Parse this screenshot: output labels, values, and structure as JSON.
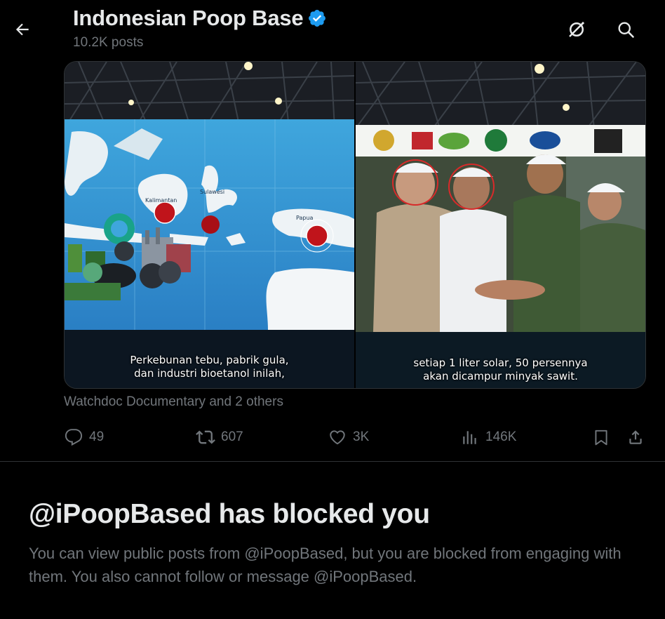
{
  "header": {
    "title": "Indonesian Poop Base",
    "subtitle": "10.2K posts",
    "icons": [
      "back-arrow-icon",
      "verified-badge-icon",
      "no-follow-icon",
      "search-icon"
    ],
    "verified_color": "#1d9bf0"
  },
  "media": {
    "left_caption_line1": "Perkebunan tebu, pabrik gula,",
    "left_caption_line2": "dan industri bioetanol inilah,",
    "left_map_labels": [
      "Kalimantan",
      "Sulawesi",
      "Papua"
    ],
    "right_caption_line1": "setiap 1 liter solar, 50 persennya",
    "right_caption_line2": "akan dicampur minyak sawit."
  },
  "attribution": "Watchdoc Documentary and 2 others",
  "actions": {
    "reply_count": "49",
    "repost_count": "607",
    "like_count": "3K",
    "views_count": "146K"
  },
  "blocked": {
    "title": "@iPoopBased has blocked you",
    "body": "You can view public posts from @iPoopBased, but you are blocked from engaging with them. You also cannot follow or message @iPoopBased."
  },
  "colors": {
    "background": "#000000",
    "text_primary": "#e7e9ea",
    "text_secondary": "#71767b",
    "divider": "#2f3336",
    "accent": "#1d9bf0"
  }
}
